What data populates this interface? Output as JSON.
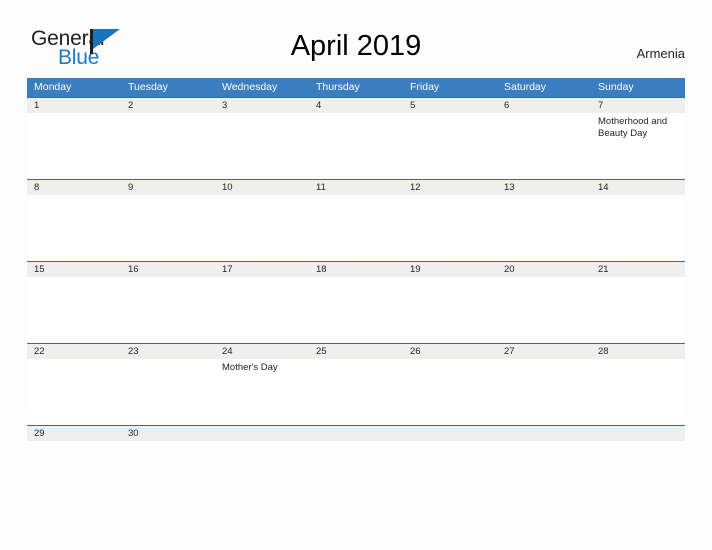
{
  "brand": {
    "name_part1": "General",
    "name_part2": "Blue",
    "flag_icon": "flag-icon",
    "colors": {
      "dark": "#231f20",
      "blue": "#1f7bc1"
    }
  },
  "header": {
    "title": "April 2019",
    "locale": "Armenia"
  },
  "theme": {
    "header_blue": "#3a7ebf",
    "separator_blue": "#2e6da4",
    "date_band_gray": "#efefee",
    "page_background": "#fdfdfd",
    "text": "#231f20"
  },
  "calendar": {
    "weekday_headers": [
      "Monday",
      "Tuesday",
      "Wednesday",
      "Thursday",
      "Friday",
      "Saturday",
      "Sunday"
    ],
    "weeks": [
      {
        "dates": [
          "1",
          "2",
          "3",
          "4",
          "5",
          "6",
          "7"
        ],
        "events": [
          "",
          "",
          "",
          "",
          "",
          "",
          "Motherhood and Beauty Day"
        ]
      },
      {
        "dates": [
          "8",
          "9",
          "10",
          "11",
          "12",
          "13",
          "14"
        ],
        "events": [
          "",
          "",
          "",
          "",
          "",
          "",
          ""
        ]
      },
      {
        "dates": [
          "15",
          "16",
          "17",
          "18",
          "19",
          "20",
          "21"
        ],
        "events": [
          "",
          "",
          "",
          "",
          "",
          "",
          ""
        ]
      },
      {
        "dates": [
          "22",
          "23",
          "24",
          "25",
          "26",
          "27",
          "28"
        ],
        "events": [
          "",
          "",
          "Mother's Day",
          "",
          "",
          "",
          ""
        ]
      },
      {
        "dates": [
          "29",
          "30",
          "",
          "",
          "",
          "",
          ""
        ],
        "events": [
          "",
          "",
          "",
          "",
          "",
          "",
          ""
        ]
      }
    ]
  }
}
